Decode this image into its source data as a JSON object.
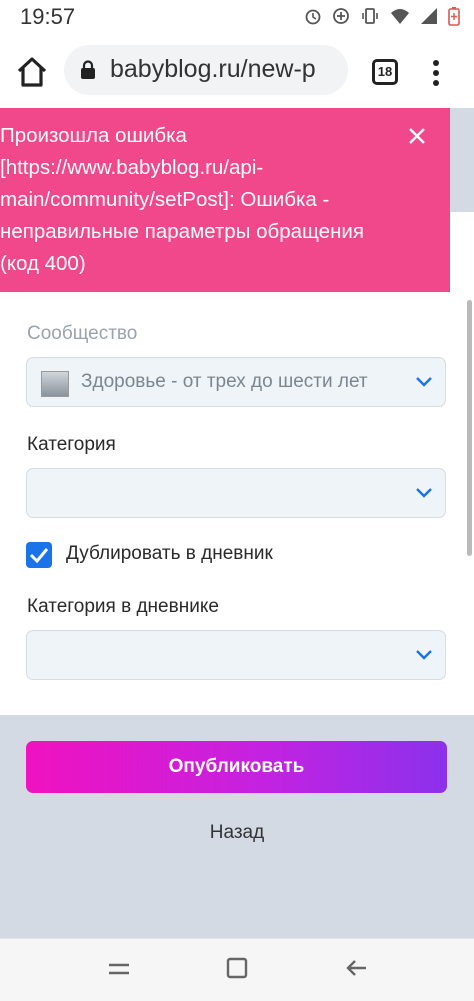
{
  "status_bar": {
    "time": "19:57",
    "icons": [
      "alarm-icon",
      "data-saver-icon",
      "vibrate-icon",
      "wifi-icon",
      "signal-icon",
      "battery-icon"
    ]
  },
  "browser": {
    "url": "babyblog.ru/new-p",
    "tab_count": "18"
  },
  "error_toast": {
    "message": "Произошла ошибка [https://www.babyblog.ru/api-main/community/setPost]: Ошибка - неправильные параметры обращения (код 400)",
    "color": "#f0488a"
  },
  "form": {
    "community_label": "Сообщество",
    "community_value": "Здоровье - от трех до шести лет",
    "category_label": "Категория",
    "category_value": "",
    "duplicate_label": "Дублировать в дневник",
    "duplicate_checked": true,
    "diary_category_label": "Категория в дневнике",
    "diary_category_value": ""
  },
  "actions": {
    "publish_label": "Опубликовать",
    "back_label": "Назад"
  },
  "colors": {
    "accent_blue": "#1a73e8",
    "button_gradient_start": "#f012c0",
    "button_gradient_end": "#8b31ec"
  }
}
